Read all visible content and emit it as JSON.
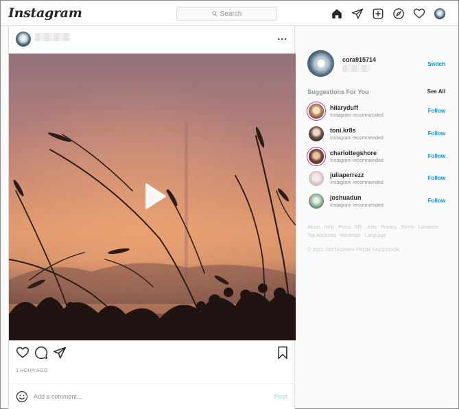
{
  "brand": {
    "logo_text": "Instagram"
  },
  "search": {
    "placeholder": "Search"
  },
  "nav": {
    "icons": [
      "home-icon",
      "direct-messages-icon",
      "new-post-icon",
      "explore-icon",
      "activity-icon"
    ]
  },
  "post": {
    "more_label": "...",
    "timestamp": "1 HOUR AGO",
    "comment_placeholder": "Add a comment...",
    "post_label": "Post"
  },
  "profile": {
    "username": "cora915714",
    "switch_label": "Switch"
  },
  "suggestions": {
    "title": "Suggestions For You",
    "see_all_label": "See All",
    "items": [
      {
        "username": "hilaryduff",
        "subtitle": "Instagram recommended",
        "follow_label": "Follow"
      },
      {
        "username": "toni.kr8s",
        "subtitle": "Instagram recommended",
        "follow_label": "Follow"
      },
      {
        "username": "charlottegshore",
        "subtitle": "Instagram recommended",
        "follow_label": "Follow"
      },
      {
        "username": "juliaperrezz",
        "subtitle": "Instagram recommended",
        "follow_label": "Follow"
      },
      {
        "username": "joshuadun",
        "subtitle": "Instagram recommended",
        "follow_label": "Follow"
      }
    ]
  },
  "footer": {
    "links": [
      "About",
      "Help",
      "Press",
      "API",
      "Jobs",
      "Privacy",
      "Terms",
      "Locations",
      "Top Accounts",
      "Hashtags",
      "Language"
    ],
    "copyright": "© 2021 INSTAGRAM FROM FACEBOOK"
  },
  "colors": {
    "accent": "#0095f6",
    "post_disabled": "#b2dffc",
    "border": "#dbdbdb",
    "muted_text": "#8e8e8e",
    "story_ring": "#d6249f"
  }
}
